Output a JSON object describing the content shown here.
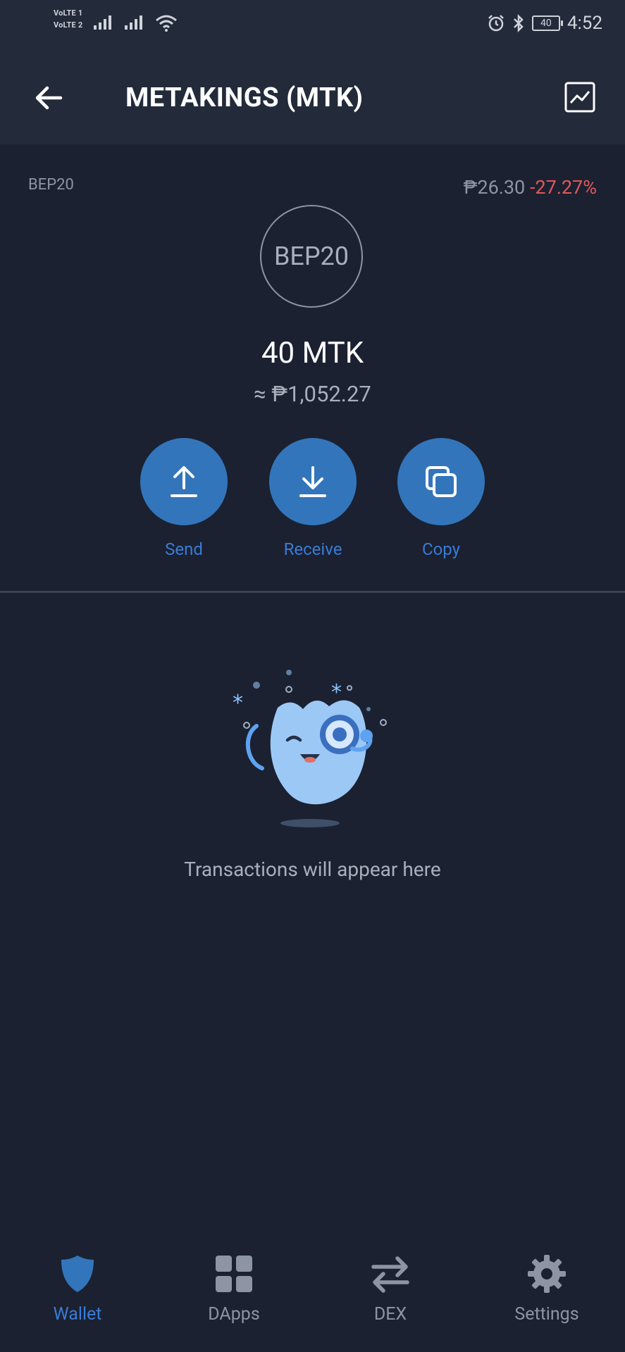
{
  "status_bar": {
    "sim1": "VoLTE 1",
    "sim2": "VoLTE 2",
    "battery": "40",
    "time": "4:52"
  },
  "header": {
    "title": "METAKINGS (MTK)",
    "back_icon": "arrow-left-icon",
    "chart_icon": "price-chart-icon"
  },
  "token": {
    "network": "BEP20",
    "price": "₱26.30",
    "change": "-27.27%",
    "logo_text": "BEP20",
    "balance": "40 MTK",
    "fiat_value": "≈ ₱1,052.27"
  },
  "actions": [
    {
      "label": "Send",
      "icon": "upload-arrow-icon"
    },
    {
      "label": "Receive",
      "icon": "download-arrow-icon"
    },
    {
      "label": "Copy",
      "icon": "copy-icon"
    }
  ],
  "empty_state": {
    "message": "Transactions will appear here"
  },
  "bottom_nav": [
    {
      "label": "Wallet",
      "icon": "shield-icon",
      "active": true
    },
    {
      "label": "DApps",
      "icon": "grid-icon",
      "active": false
    },
    {
      "label": "DEX",
      "icon": "swap-arrows-icon",
      "active": false
    },
    {
      "label": "Settings",
      "icon": "gear-icon",
      "active": false
    }
  ],
  "colors": {
    "background": "#1b2131",
    "header": "#232a39",
    "accent": "#3375bb",
    "negative": "#e25858"
  }
}
